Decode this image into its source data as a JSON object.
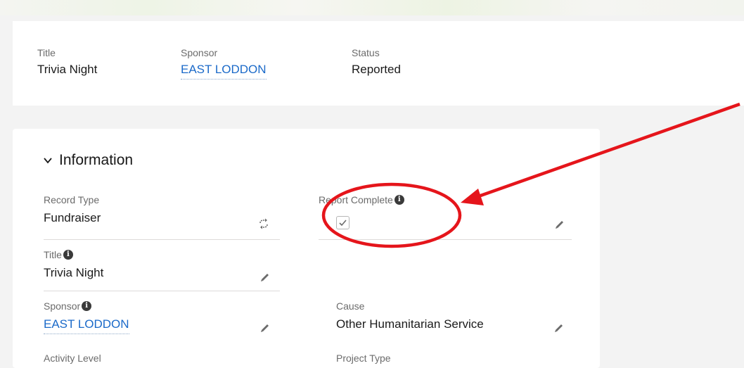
{
  "header": {
    "fields": [
      {
        "label": "Title",
        "value": "Trivia Night"
      },
      {
        "label": "Sponsor",
        "value": "EAST LODDON"
      },
      {
        "label": "Status",
        "value": "Reported"
      }
    ]
  },
  "section": {
    "title": "Information"
  },
  "fields": {
    "record_type": {
      "label": "Record Type",
      "value": "Fundraiser"
    },
    "report_complete": {
      "label": "Report Complete",
      "checked": true
    },
    "title": {
      "label": "Title",
      "value": "Trivia Night"
    },
    "sponsor": {
      "label": "Sponsor",
      "value": "EAST LODDON"
    },
    "cause": {
      "label": "Cause",
      "value": "Other Humanitarian Service"
    },
    "activity_level": {
      "label": "Activity Level"
    },
    "project_type": {
      "label": "Project Type"
    }
  },
  "info_icon_glyph": "i",
  "annotation": {
    "color": "#e5151b",
    "shapes": [
      "ellipse",
      "arrow"
    ]
  },
  "icons": [
    "chevron-down-icon",
    "info-icon",
    "pencil-icon",
    "change-record-type-icon",
    "checkmark-icon"
  ]
}
